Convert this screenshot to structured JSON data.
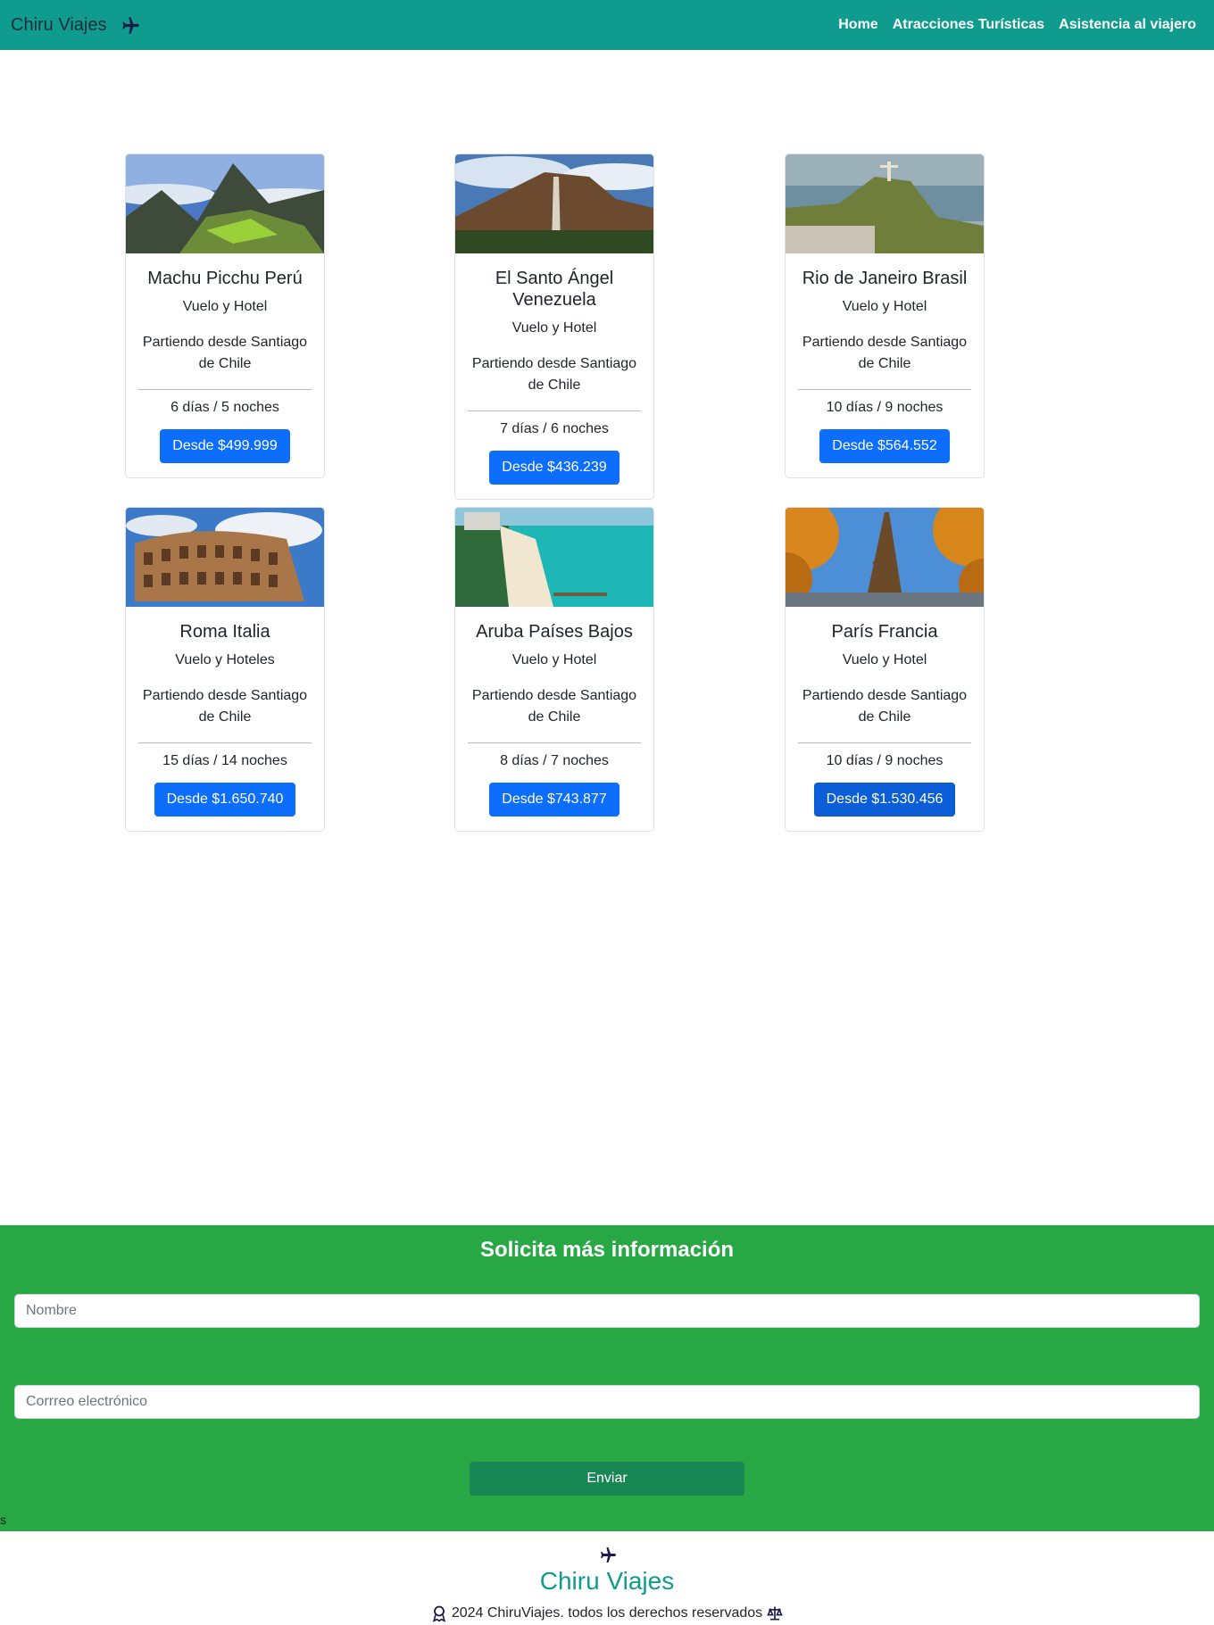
{
  "navbar": {
    "brand": "Chiru Viajes",
    "brand_icon": "plane-icon",
    "links": [
      "Home",
      "Atracciones Turísticas",
      "Asistencia al viajero"
    ]
  },
  "cards": [
    {
      "title": "Machu Picchu Perú",
      "subtitle": "Vuelo y Hotel",
      "origin": "Partiendo desde Santiago de Chile",
      "duration": "6 días / 5 noches",
      "price": "Desde $499.999"
    },
    {
      "title": "El Santo Ángel Venezuela",
      "subtitle": "Vuelo y Hotel",
      "origin": "Partiendo desde Santiago de Chile",
      "duration": "7 días / 6 noches",
      "price": "Desde $436.239"
    },
    {
      "title": "Rio de Janeiro Brasil",
      "subtitle": "Vuelo y Hotel",
      "origin": "Partiendo desde Santiago de Chile",
      "duration": "10 días / 9 noches",
      "price": "Desde $564.552"
    },
    {
      "title": "Roma Italia",
      "subtitle": "Vuelo y Hoteles",
      "origin": "Partiendo desde Santiago de Chile",
      "duration": "15 días / 14 noches",
      "price": "Desde $1.650.740"
    },
    {
      "title": "Aruba Países Bajos",
      "subtitle": "Vuelo y Hotel",
      "origin": "Partiendo desde Santiago de Chile",
      "duration": "8 días / 7 noches",
      "price": "Desde $743.877"
    },
    {
      "title": "París Francia",
      "subtitle": "Vuelo y Hotel",
      "origin": "Partiendo desde Santiago de Chile",
      "duration": "10 días / 9 noches",
      "price": "Desde $1.530.456"
    }
  ],
  "form": {
    "title": "Solicita más información",
    "name_placeholder": "Nombre",
    "email_placeholder": "Corrreo electrónico",
    "submit_label": "Enviar",
    "stray_text": "s"
  },
  "footer": {
    "name": "Chiru Viajes",
    "copyright": "2024 ChiruViajes. todos los derechos reservados"
  },
  "colors": {
    "navbar": "#0f9b8e",
    "form_bg": "#28a745",
    "primary_button": "#0d6efd",
    "submit_button": "#198754"
  }
}
